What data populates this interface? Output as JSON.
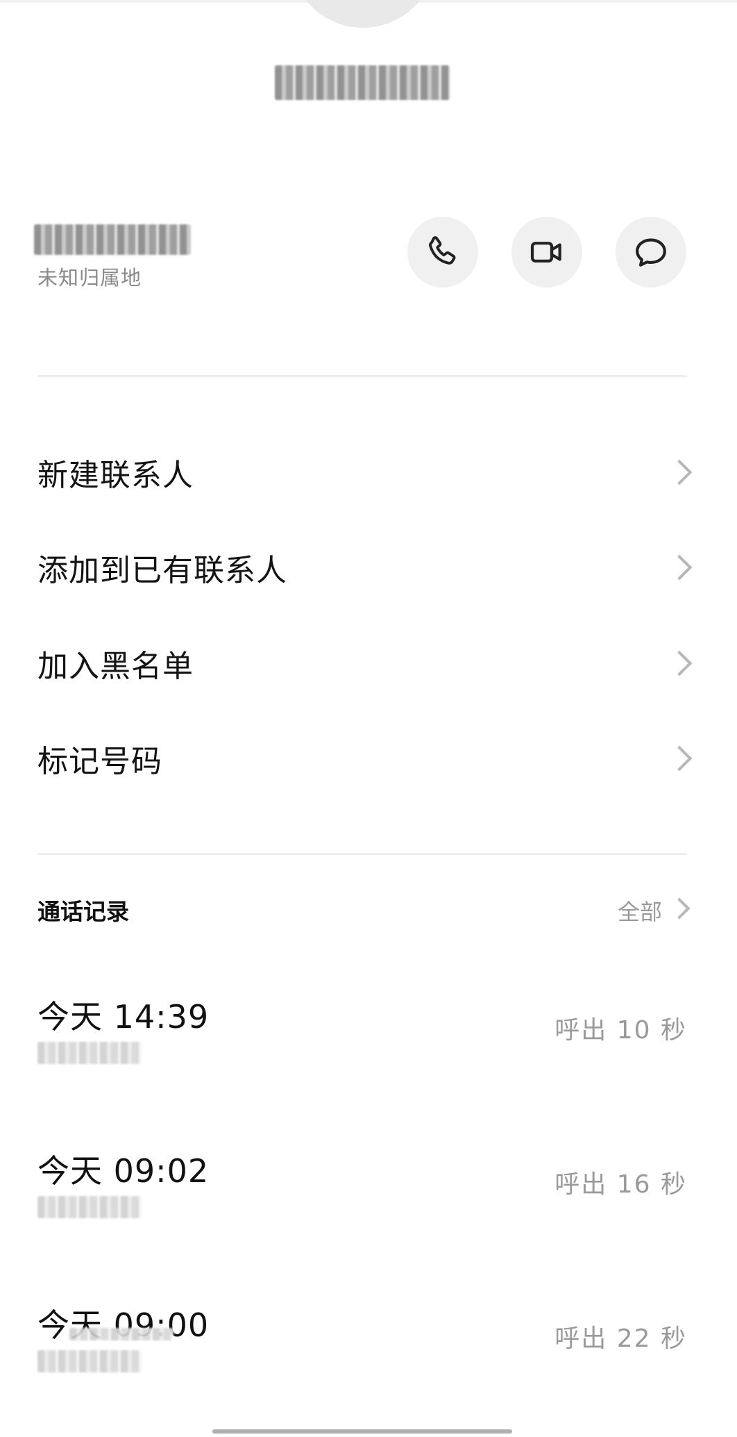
{
  "header": {
    "location": "未知归属地"
  },
  "actions": {
    "call_icon": "phone-icon",
    "video_icon": "video-camera-icon",
    "message_icon": "message-bubble-icon"
  },
  "menu": [
    {
      "label": "新建联系人"
    },
    {
      "label": "添加到已有联系人"
    },
    {
      "label": "加入黑名单"
    },
    {
      "label": "标记号码"
    }
  ],
  "call_history": {
    "title": "通话记录",
    "see_all": "全部",
    "records": [
      {
        "time": "今天 14:39",
        "detail": "呼出 10 秒"
      },
      {
        "time": "今天 09:02",
        "detail": "呼出 16 秒"
      },
      {
        "time": "今天 09:00",
        "detail": "呼出 22 秒"
      }
    ]
  }
}
